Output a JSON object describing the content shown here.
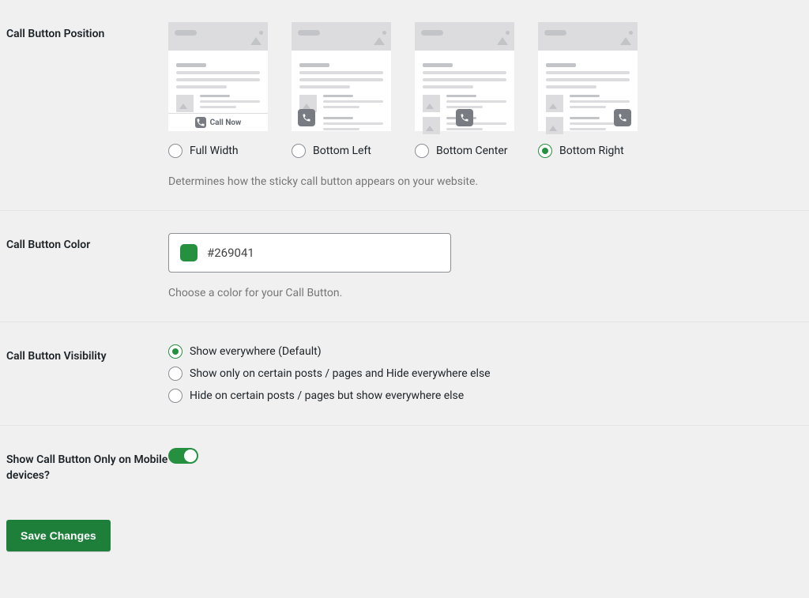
{
  "position": {
    "label": "Call Button Position",
    "options": [
      {
        "key": "full_width",
        "label": "Full Width",
        "selected": false,
        "call_now_text": "Call Now"
      },
      {
        "key": "bottom_left",
        "label": "Bottom Left",
        "selected": false
      },
      {
        "key": "bottom_center",
        "label": "Bottom Center",
        "selected": false
      },
      {
        "key": "bottom_right",
        "label": "Bottom Right",
        "selected": true
      }
    ],
    "description": "Determines how the sticky call button appears on your website."
  },
  "color": {
    "label": "Call Button Color",
    "value": "#269041",
    "description": "Choose a color for your Call Button."
  },
  "visibility": {
    "label": "Call Button Visibility",
    "options": [
      {
        "label": "Show everywhere (Default)",
        "selected": true
      },
      {
        "label": "Show only on certain posts / pages and Hide everywhere else",
        "selected": false
      },
      {
        "label": "Hide on certain posts / pages but show everywhere else",
        "selected": false
      }
    ]
  },
  "mobile_only": {
    "label": "Show Call Button Only on Mobile devices?",
    "value": true
  },
  "actions": {
    "save": "Save Changes"
  }
}
